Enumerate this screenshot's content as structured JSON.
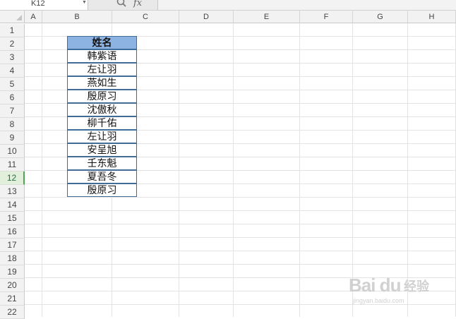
{
  "formula_bar": {
    "name_box": "K12",
    "fx_label": "fx"
  },
  "columns": [
    "A",
    "B",
    "C",
    "D",
    "E",
    "F",
    "G",
    "H"
  ],
  "rows": [
    "1",
    "2",
    "3",
    "4",
    "5",
    "6",
    "7",
    "8",
    "9",
    "10",
    "11",
    "12",
    "13",
    "14",
    "15",
    "16",
    "17",
    "18",
    "19",
    "20",
    "21",
    "22"
  ],
  "active_row": "12",
  "table": {
    "header": "姓名",
    "names": [
      "韩紫语",
      "左让羽",
      "燕如生",
      "殷原习",
      "沈傲秋",
      "柳千佑",
      "左让羽",
      "安呈旭",
      "壬东魁",
      "夏吾冬",
      "殷原习"
    ]
  },
  "colors": {
    "header_fill": "#8db3e2",
    "border": "#3f6d98",
    "active_row": "#53a356"
  },
  "watermark": {
    "brand": "Bai du",
    "cn": "经验",
    "url": "jingyan.baidu.com"
  }
}
